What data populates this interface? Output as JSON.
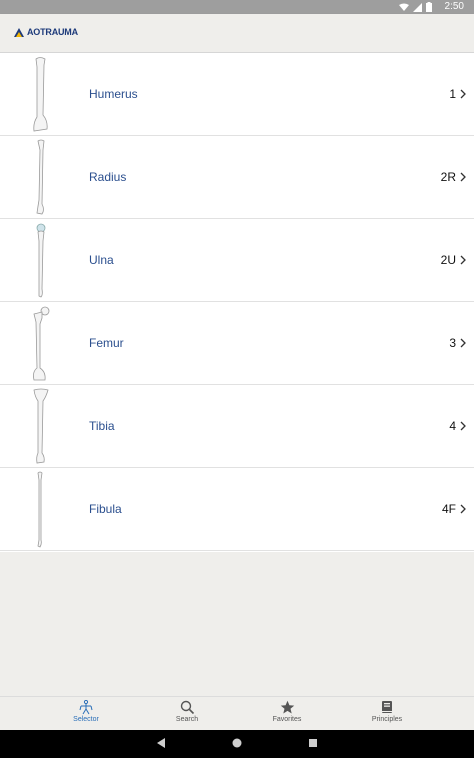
{
  "status_bar": {
    "time": "2:50"
  },
  "app_bar": {
    "logo_prefix": "AO",
    "logo_text": "TRAUMA"
  },
  "bones": [
    {
      "name": "Humerus",
      "code": "1"
    },
    {
      "name": "Radius",
      "code": "2R"
    },
    {
      "name": "Ulna",
      "code": "2U"
    },
    {
      "name": "Femur",
      "code": "3"
    },
    {
      "name": "Tibia",
      "code": "4"
    },
    {
      "name": "Fibula",
      "code": "4F"
    }
  ],
  "bottom_nav": {
    "selector": "Selector",
    "search": "Search",
    "favorites": "Favorites",
    "principles": "Principles",
    "active_tab": "Selector"
  },
  "colors": {
    "accent": "#2b6fb8",
    "bone_name": "#2b4f8e",
    "logo": "#1d3a7a"
  }
}
